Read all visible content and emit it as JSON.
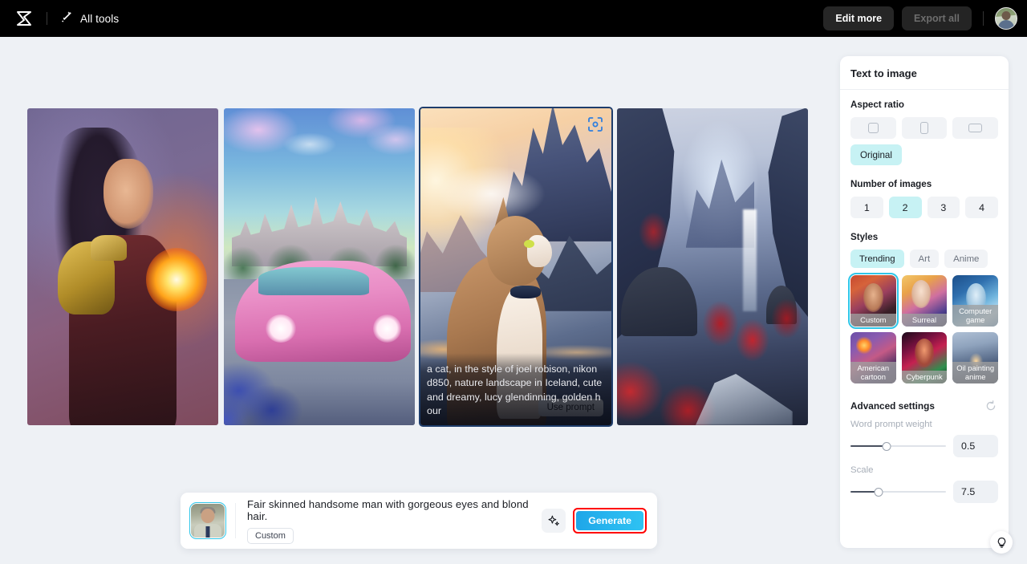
{
  "topbar": {
    "logo_icon": "capcut-logo-icon",
    "all_tools_icon": "wand-sparkle-icon",
    "all_tools_label": "All tools",
    "edit_more_label": "Edit more",
    "export_all_label": "Export all",
    "avatar_icon": "user-avatar"
  },
  "gallery": {
    "cards": [
      {
        "name": "fantasy-warrior-woman",
        "selected": false
      },
      {
        "name": "castle-with-pink-car",
        "selected": false
      },
      {
        "name": "cat-in-iceland-landscape",
        "selected": true
      },
      {
        "name": "red-valley-pagoda",
        "selected": false
      }
    ],
    "selected_card": {
      "focus_icon": "focus-scan-icon",
      "prompt_text": "a cat, in the style of joel robison, nikon d850, nature landscape in Iceland, cute and dreamy, lucy glendinning, golden hour",
      "use_prompt_label": "Use prompt"
    }
  },
  "panel": {
    "title": "Text to image",
    "aspect_ratio": {
      "label": "Aspect ratio",
      "options": [
        {
          "name": "square",
          "icon": "square-icon"
        },
        {
          "name": "portrait",
          "icon": "portrait-rect-icon"
        },
        {
          "name": "landscape",
          "icon": "landscape-rect-icon"
        }
      ],
      "original_label": "Original",
      "selected": "Original"
    },
    "number_of_images": {
      "label": "Number of images",
      "options": [
        "1",
        "2",
        "3",
        "4"
      ],
      "selected": "2"
    },
    "styles": {
      "label": "Styles",
      "tabs": [
        "Trending",
        "Art",
        "Anime"
      ],
      "selected_tab": "Trending",
      "items": [
        {
          "label": "Custom",
          "selected": true
        },
        {
          "label": "Surreal",
          "selected": false
        },
        {
          "label": "Computer game",
          "selected": false
        },
        {
          "label": "American cartoon",
          "selected": false
        },
        {
          "label": "Cyberpunk",
          "selected": false
        },
        {
          "label": "Oil painting anime",
          "selected": false
        }
      ]
    },
    "advanced": {
      "label": "Advanced settings",
      "reset_icon": "reset-circular-arrow-icon",
      "word_prompt_weight": {
        "label": "Word prompt weight",
        "value": "0.5",
        "percent": 38
      },
      "scale": {
        "label": "Scale",
        "value": "7.5",
        "percent": 29
      }
    }
  },
  "prompt_bar": {
    "avatar_icon": "reference-image-thumbnail",
    "prompt_value": "Fair skinned handsome man with gorgeous eyes and blond hair.",
    "style_chip": "Custom",
    "sparkle_icon": "magic-sparkle-icon",
    "generate_label": "Generate"
  },
  "help": {
    "icon": "lightbulb-icon"
  },
  "colors": {
    "accent_cyan": "#c7f2f4",
    "selection_cyan": "#2fc6e8",
    "generate_blue": "#28b6ef",
    "highlight_red": "#ff0000",
    "topbar_black": "#000000",
    "canvas_bg": "#eef1f5"
  }
}
